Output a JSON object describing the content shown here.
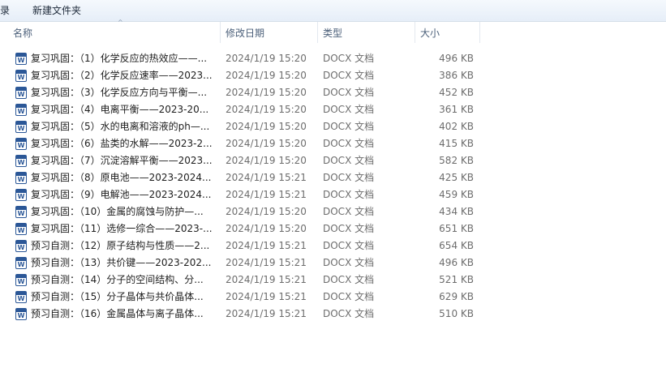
{
  "toolbar": {
    "left_label": "录",
    "new_folder_label": "新建文件夹"
  },
  "columns": {
    "name": "名称",
    "date": "修改日期",
    "type": "类型",
    "size": "大小"
  },
  "files": [
    {
      "name": "复习巩固：（1）化学反应的热效应——...",
      "date": "2024/1/19 15:20",
      "type": "DOCX 文档",
      "size": "496 KB"
    },
    {
      "name": "复习巩固：（2）化学反应速率——2023...",
      "date": "2024/1/19 15:20",
      "type": "DOCX 文档",
      "size": "386 KB"
    },
    {
      "name": "复习巩固：（3）化学反应方向与平衡—...",
      "date": "2024/1/19 15:20",
      "type": "DOCX 文档",
      "size": "452 KB"
    },
    {
      "name": "复习巩固：（4）电离平衡——2023-20...",
      "date": "2024/1/19 15:20",
      "type": "DOCX 文档",
      "size": "361 KB"
    },
    {
      "name": "复习巩固：（5）水的电离和溶液的ph—...",
      "date": "2024/1/19 15:20",
      "type": "DOCX 文档",
      "size": "402 KB"
    },
    {
      "name": "复习巩固：（6）盐类的水解——2023-2...",
      "date": "2024/1/19 15:20",
      "type": "DOCX 文档",
      "size": "415 KB"
    },
    {
      "name": "复习巩固：（7）沉淀溶解平衡——2023...",
      "date": "2024/1/19 15:20",
      "type": "DOCX 文档",
      "size": "582 KB"
    },
    {
      "name": "复习巩固：（8）原电池——2023-2024...",
      "date": "2024/1/19 15:21",
      "type": "DOCX 文档",
      "size": "425 KB"
    },
    {
      "name": "复习巩固：（9）电解池——2023-2024...",
      "date": "2024/1/19 15:21",
      "type": "DOCX 文档",
      "size": "459 KB"
    },
    {
      "name": "复习巩固：（10）金属的腐蚀与防护—...",
      "date": "2024/1/19 15:20",
      "type": "DOCX 文档",
      "size": "434 KB"
    },
    {
      "name": "复习巩固：（11）选修一综合——2023-...",
      "date": "2024/1/19 15:20",
      "type": "DOCX 文档",
      "size": "651 KB"
    },
    {
      "name": "预习自测：（12）原子结构与性质——2...",
      "date": "2024/1/19 15:21",
      "type": "DOCX 文档",
      "size": "654 KB"
    },
    {
      "name": "预习自测：（13）共价键——2023-202...",
      "date": "2024/1/19 15:21",
      "type": "DOCX 文档",
      "size": "496 KB"
    },
    {
      "name": "预习自测：（14）分子的空间结构、分...",
      "date": "2024/1/19 15:21",
      "type": "DOCX 文档",
      "size": "521 KB"
    },
    {
      "name": "预习自测：（15）分子晶体与共价晶体...",
      "date": "2024/1/19 15:21",
      "type": "DOCX 文档",
      "size": "629 KB"
    },
    {
      "name": "预习自测：（16）金属晶体与离子晶体...",
      "date": "2024/1/19 15:21",
      "type": "DOCX 文档",
      "size": "510 KB"
    }
  ],
  "icon": {
    "file": "word-document-icon",
    "file_letter": "W",
    "sort": "sort-ascending-icon",
    "sort_glyph": "^"
  }
}
